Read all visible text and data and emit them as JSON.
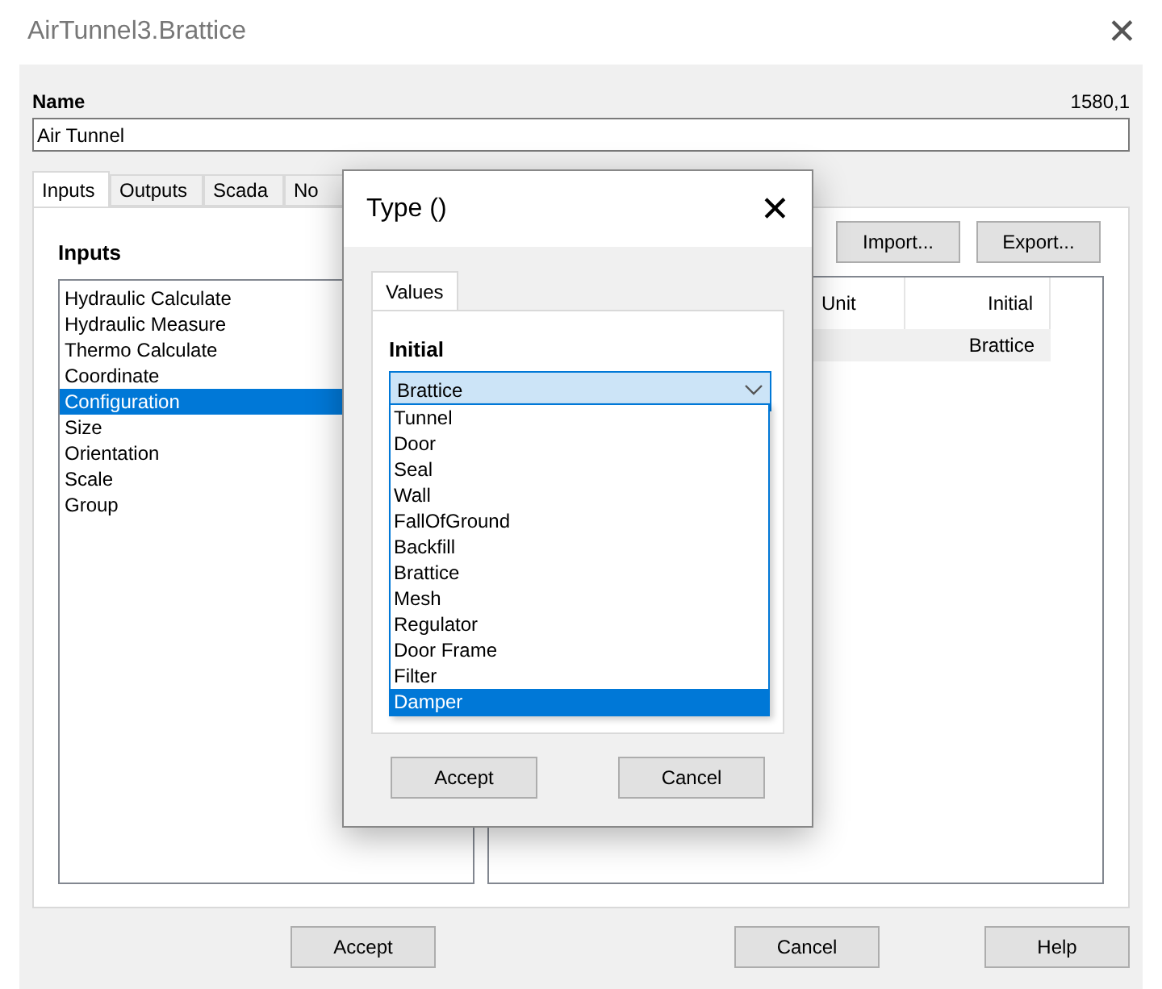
{
  "window": {
    "title": "AirTunnel3.Brattice",
    "close": "✕"
  },
  "name": {
    "label": "Name",
    "value": "Air Tunnel",
    "code": "1580,1"
  },
  "tabs": [
    {
      "label": "Inputs",
      "selected": true
    },
    {
      "label": "Outputs",
      "selected": false
    },
    {
      "label": "Scada",
      "selected": false
    },
    {
      "label": "No",
      "selected": false
    }
  ],
  "inputs": {
    "label": "Inputs",
    "items": [
      {
        "label": "Hydraulic Calculate",
        "selected": false
      },
      {
        "label": "Hydraulic Measure",
        "selected": false
      },
      {
        "label": "Thermo Calculate",
        "selected": false
      },
      {
        "label": "Coordinate",
        "selected": false
      },
      {
        "label": "Configuration",
        "selected": true
      },
      {
        "label": "Size",
        "selected": false
      },
      {
        "label": "Orientation",
        "selected": false
      },
      {
        "label": "Scale",
        "selected": false
      },
      {
        "label": "Group",
        "selected": false
      }
    ]
  },
  "tools": [
    "Import...",
    "Export..."
  ],
  "table": {
    "columns": [
      "Unit",
      "Initial"
    ],
    "rows": [
      [
        "",
        "Brattice"
      ]
    ]
  },
  "buttons": [
    "Accept",
    "Cancel",
    "Help"
  ],
  "dialog": {
    "title": "Type ()",
    "close": "✕",
    "tabs": [
      {
        "label": "Values",
        "selected": true
      }
    ],
    "field_label": "Initial",
    "value": "Brattice",
    "options": [
      {
        "label": "Tunnel",
        "highlighted": false
      },
      {
        "label": "Door",
        "highlighted": false
      },
      {
        "label": "Seal",
        "highlighted": false
      },
      {
        "label": "Wall",
        "highlighted": false
      },
      {
        "label": "FallOfGround",
        "highlighted": false
      },
      {
        "label": "Backfill",
        "highlighted": false
      },
      {
        "label": "Brattice",
        "highlighted": false
      },
      {
        "label": "Mesh",
        "highlighted": false
      },
      {
        "label": "Regulator",
        "highlighted": false
      },
      {
        "label": "Door Frame",
        "highlighted": false
      },
      {
        "label": "Filter",
        "highlighted": false
      },
      {
        "label": "Damper",
        "highlighted": true
      }
    ],
    "buttons": [
      "Accept",
      "Cancel"
    ]
  }
}
